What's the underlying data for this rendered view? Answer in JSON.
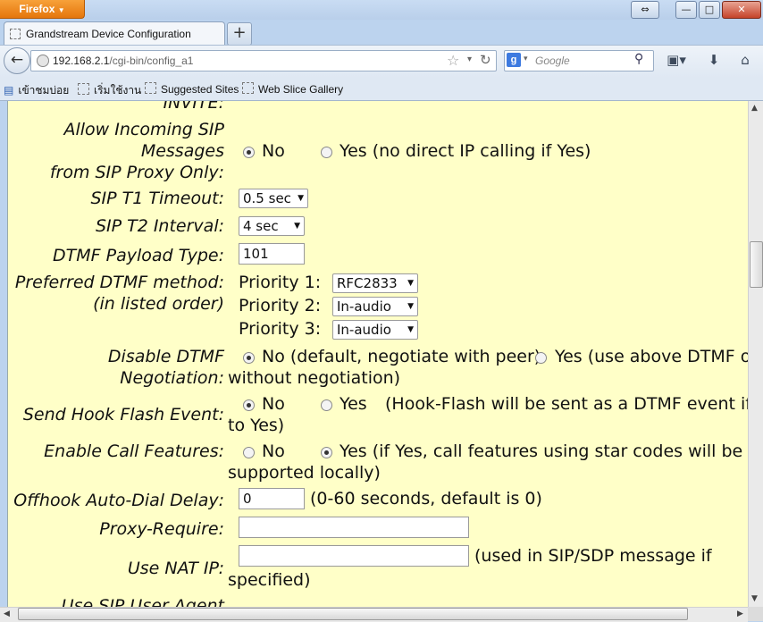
{
  "window": {
    "app_button": "Firefox",
    "app_button_arrow": "▼",
    "restore_icon": "⇔",
    "min_icon": "—",
    "max_icon": "□",
    "close_icon": "✕"
  },
  "tab": {
    "title": "Grandstream Device Configuration",
    "new_tab": "+"
  },
  "nav": {
    "back_icon": "←",
    "url_host": "192.168.2.1",
    "url_path": "/cgi-bin/config_a1",
    "search_engine": "g",
    "search_placeholder": "Google"
  },
  "bookmarks": [
    "เข้าชมบ่อย",
    "เริ่มใช้งาน",
    "Suggested Sites",
    "Web Slice Gallery"
  ],
  "form": {
    "invite_tail": "INVITE:",
    "allow_incoming": {
      "label_lines": [
        "Allow Incoming SIP",
        "Messages",
        "from SIP Proxy Only:"
      ],
      "options": [
        "No",
        "Yes (no direct IP calling if Yes)"
      ],
      "selected": 0
    },
    "t1": {
      "label": "SIP T1 Timeout:",
      "value": "0.5 sec"
    },
    "t2": {
      "label": "SIP T2 Interval:",
      "value": "4 sec"
    },
    "dtmf_payload": {
      "label": "DTMF Payload Type:",
      "value": "101"
    },
    "pref_dtmf": {
      "label_lines": [
        "Preferred DTMF method:",
        "(in listed order)"
      ],
      "priorities": [
        {
          "label": "Priority 1:",
          "value": "RFC2833"
        },
        {
          "label": "Priority 2:",
          "value": "In-audio"
        },
        {
          "label": "Priority 3:",
          "value": "In-audio"
        }
      ]
    },
    "disable_dtmf": {
      "label_lines": [
        "Disable DTMF",
        "Negotiation:"
      ],
      "options": [
        "No (default, negotiate with peer)",
        "Yes (use above DTMF or"
      ],
      "wrap": "without negotiation)",
      "selected": 0
    },
    "hook_flash": {
      "label": "Send Hook Flash Event:",
      "options": [
        "No",
        "Yes"
      ],
      "note": "(Hook-Flash will be sent as a DTMF event if se",
      "wrap": "to Yes)",
      "selected": 0
    },
    "call_features": {
      "label": "Enable Call Features:",
      "options": [
        "No",
        "Yes (if Yes, call features using star codes will be"
      ],
      "wrap": "supported locally)",
      "selected": 1
    },
    "offhook": {
      "label": "Offhook Auto-Dial Delay:",
      "value": "0",
      "note": "(0-60 seconds, default is 0)"
    },
    "proxy_require": {
      "label": "Proxy-Require:",
      "value": ""
    },
    "nat_ip": {
      "label": "Use NAT IP:",
      "value": "",
      "note": "(used in SIP/SDP message if",
      "wrap": "specified)"
    },
    "next_cut": "Use SIP User Agent"
  }
}
